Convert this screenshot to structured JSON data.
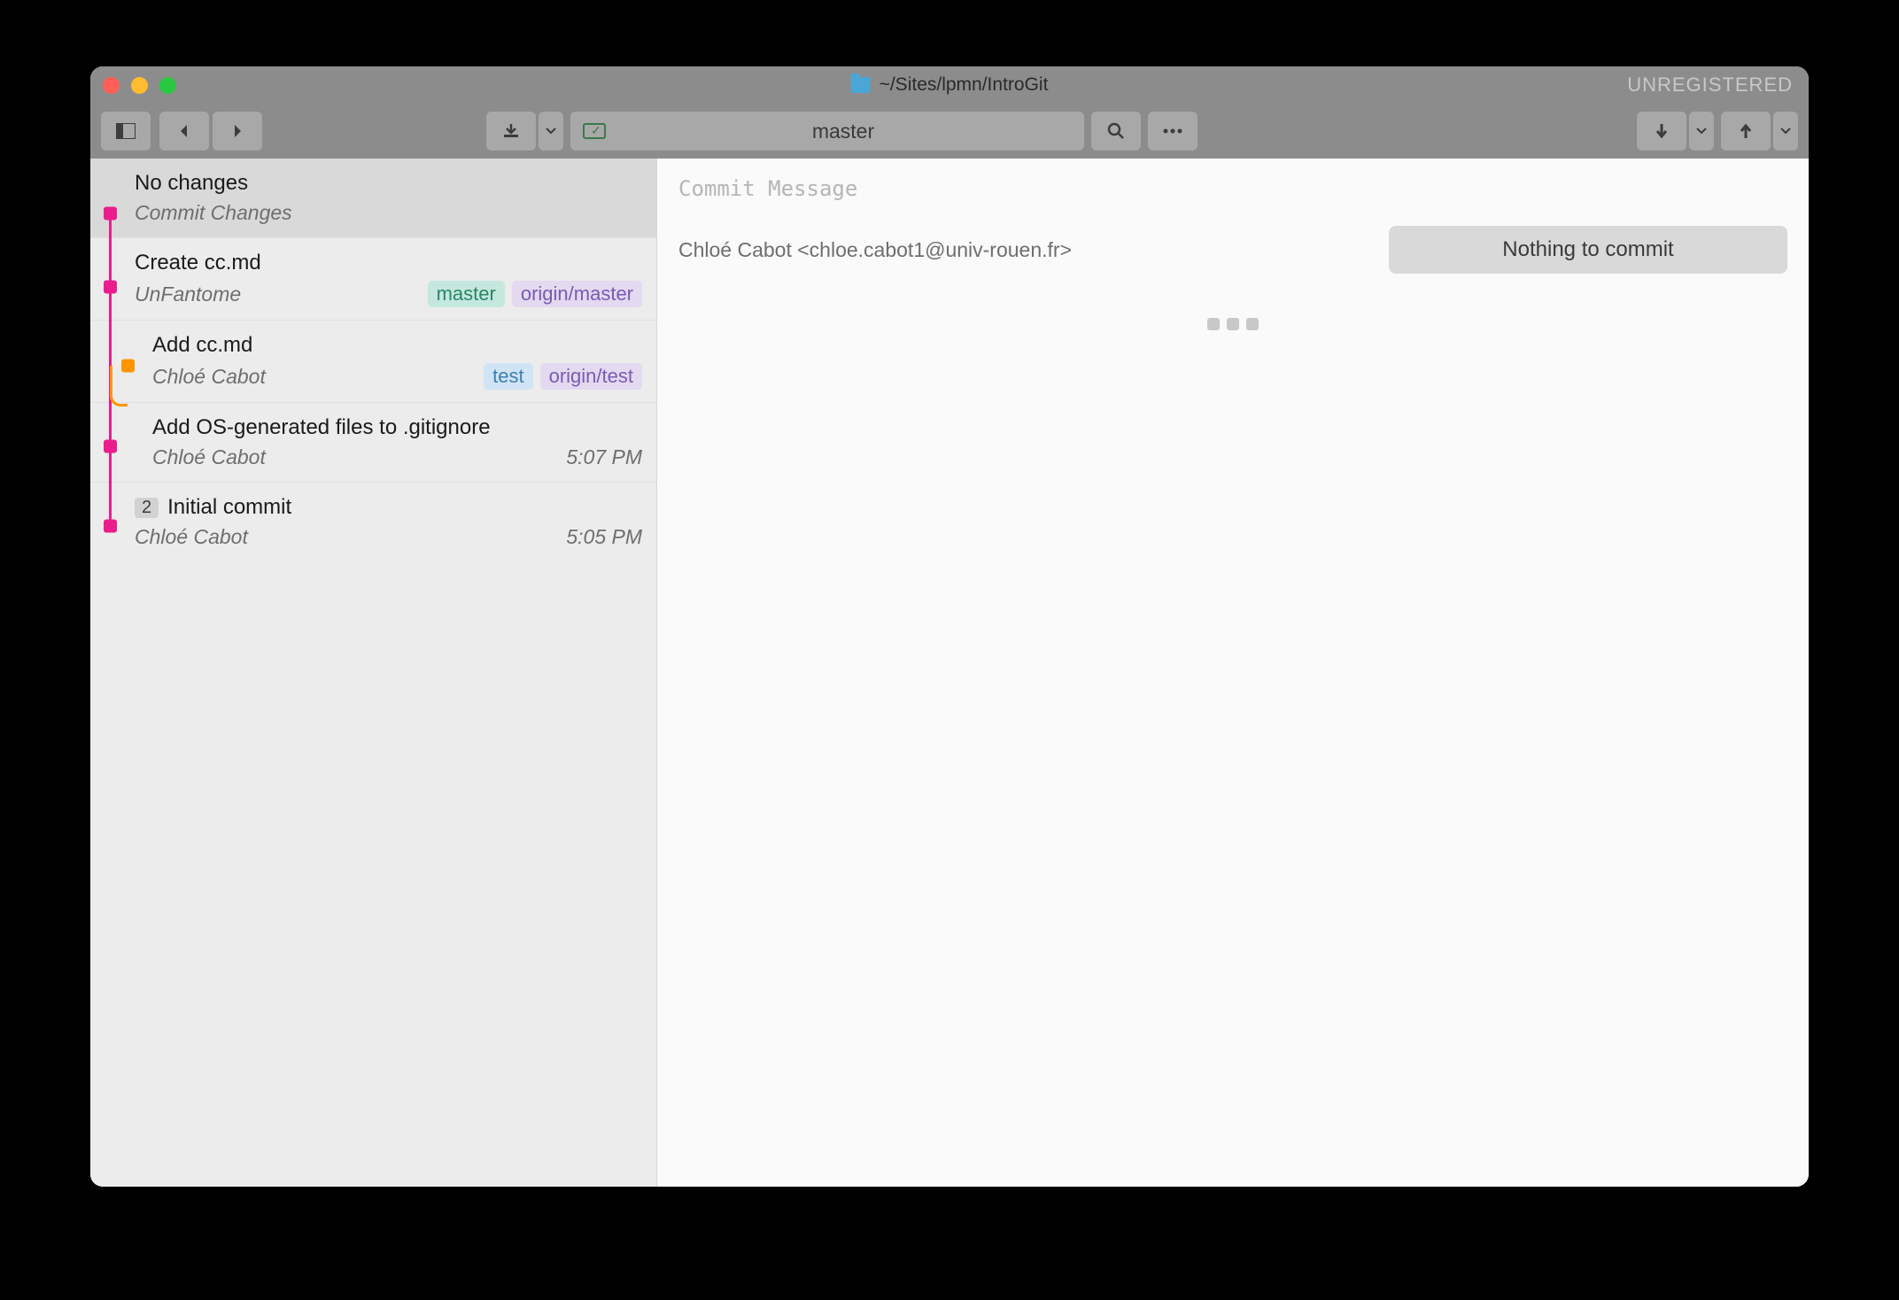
{
  "titlebar": {
    "path": "~/Sites/lpmn/IntroGit",
    "unregistered": "UNREGISTERED"
  },
  "toolbar": {
    "branch": "master"
  },
  "commits": [
    {
      "title": "No changes",
      "subtitle": "Commit Changes"
    },
    {
      "title": "Create cc.md",
      "author": "UnFantome",
      "tags": [
        {
          "label": "master",
          "cls": "tag-green"
        },
        {
          "label": "origin/master",
          "cls": "tag-purple"
        }
      ]
    },
    {
      "title": "Add cc.md",
      "author": "Chloé Cabot",
      "tags": [
        {
          "label": "test",
          "cls": "tag-blue"
        },
        {
          "label": "origin/test",
          "cls": "tag-purple"
        }
      ]
    },
    {
      "title": "Add OS-generated files to .gitignore",
      "author": "Chloé Cabot",
      "time": "5:07 PM"
    },
    {
      "badge": "2",
      "title": "Initial commit",
      "author": "Chloé Cabot",
      "time": "5:05 PM"
    }
  ],
  "main": {
    "commit_message_placeholder": "Commit Message",
    "author": "Chloé Cabot <chloe.cabot1@univ-rouen.fr>",
    "commit_button": "Nothing to commit"
  }
}
